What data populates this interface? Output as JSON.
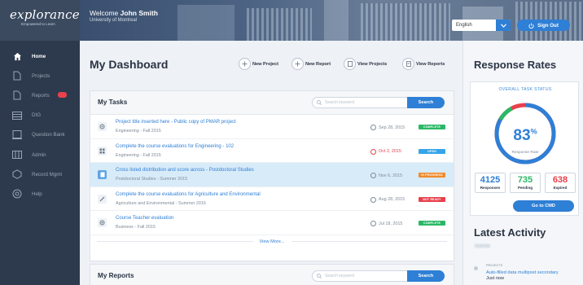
{
  "brand": {
    "logo": "explorance",
    "tagline": "Empowered to Learn"
  },
  "header": {
    "welcome_prefix": "Welcome",
    "user_name": "John Smith",
    "university": "University of Montreal",
    "language": "English",
    "signout_label": "Sign Out"
  },
  "sidebar": {
    "items": [
      {
        "label": "Home",
        "icon": "home-icon",
        "active": true
      },
      {
        "label": "Projects",
        "icon": "projects-icon"
      },
      {
        "label": "Reports",
        "icon": "reports-icon",
        "badge": true
      },
      {
        "label": "DIG",
        "icon": "dig-icon"
      },
      {
        "label": "Question Bank",
        "icon": "question-bank-icon"
      },
      {
        "label": "Admin",
        "icon": "admin-icon"
      },
      {
        "label": "Record Mgmt",
        "icon": "record-mgmt-icon"
      },
      {
        "label": "Help",
        "icon": "help-icon"
      }
    ]
  },
  "dashboard": {
    "title": "My Dashboard",
    "actions": {
      "new_project": "New Project",
      "new_report": "New Report",
      "view_projects": "View Projects",
      "view_reports": "View Reports"
    }
  },
  "tasks": {
    "title": "My Tasks",
    "search_placeholder": "Search keyword",
    "search_button": "Search",
    "view_more": "View More...",
    "items": [
      {
        "name": "Project title inserted here - Public copy of PMAR project",
        "meta": "Engineering  -  Fall 2015",
        "date": "Sep 28, 2015",
        "status": "COMPLETE",
        "status_color": "#2bb866",
        "date_red": false
      },
      {
        "name": "Complete the course evaluations for Engineering - 102",
        "meta": "Engineering  -  Fall 2015",
        "date": "Oct 2, 2015",
        "status": "OPEN",
        "status_color": "#35a4e8",
        "date_red": true
      },
      {
        "name": "Cross listed distribution and score across - Postdoctoral Studies",
        "meta": "Postdoctoral Studies  -  Summer 2015",
        "date": "Nov 6, 2015",
        "status": "IN PROGRESS",
        "status_color": "#f18a2a",
        "date_red": false
      },
      {
        "name": "Complete the course evaluations for Agriculture and Environmental",
        "meta": "Agriculture and Environmental  -  Summer 2015",
        "date": "Aug 28, 2015",
        "status": "NOT READY",
        "status_color": "#e8414c",
        "date_red": false
      },
      {
        "name": "Course Teacher evaluation",
        "meta": "Business  -  Fall 2015",
        "date": "Jul 18, 2015",
        "status": "COMPLETE",
        "status_color": "#2bb866",
        "date_red": false
      }
    ]
  },
  "reports": {
    "title": "My Reports",
    "search_placeholder": "Search keyword",
    "search_button": "Search"
  },
  "response_rates": {
    "title": "Response Rates",
    "overall_label": "OVERALL TASK STATUS",
    "percent": "83",
    "percent_symbol": "%",
    "percent_value": 83,
    "sub_label": "Response Rate",
    "stats": [
      {
        "value": "4125",
        "label": "Responses",
        "color": "#2e7fd6"
      },
      {
        "value": "735",
        "label": "Pending",
        "color": "#2bb866"
      },
      {
        "value": "638",
        "label": "Expired",
        "color": "#e8414c"
      }
    ],
    "goto_label": "Go to CMD"
  },
  "latest_activity": {
    "title": "Latest Activity",
    "date_chip": "Yesterday",
    "item": {
      "type": "PROJECTS",
      "text": "Auto-filled data multipost secondary",
      "time": "Just now"
    }
  },
  "colors": {
    "accent": "#2e7fd6",
    "sidebar": "#2d3a4d"
  }
}
